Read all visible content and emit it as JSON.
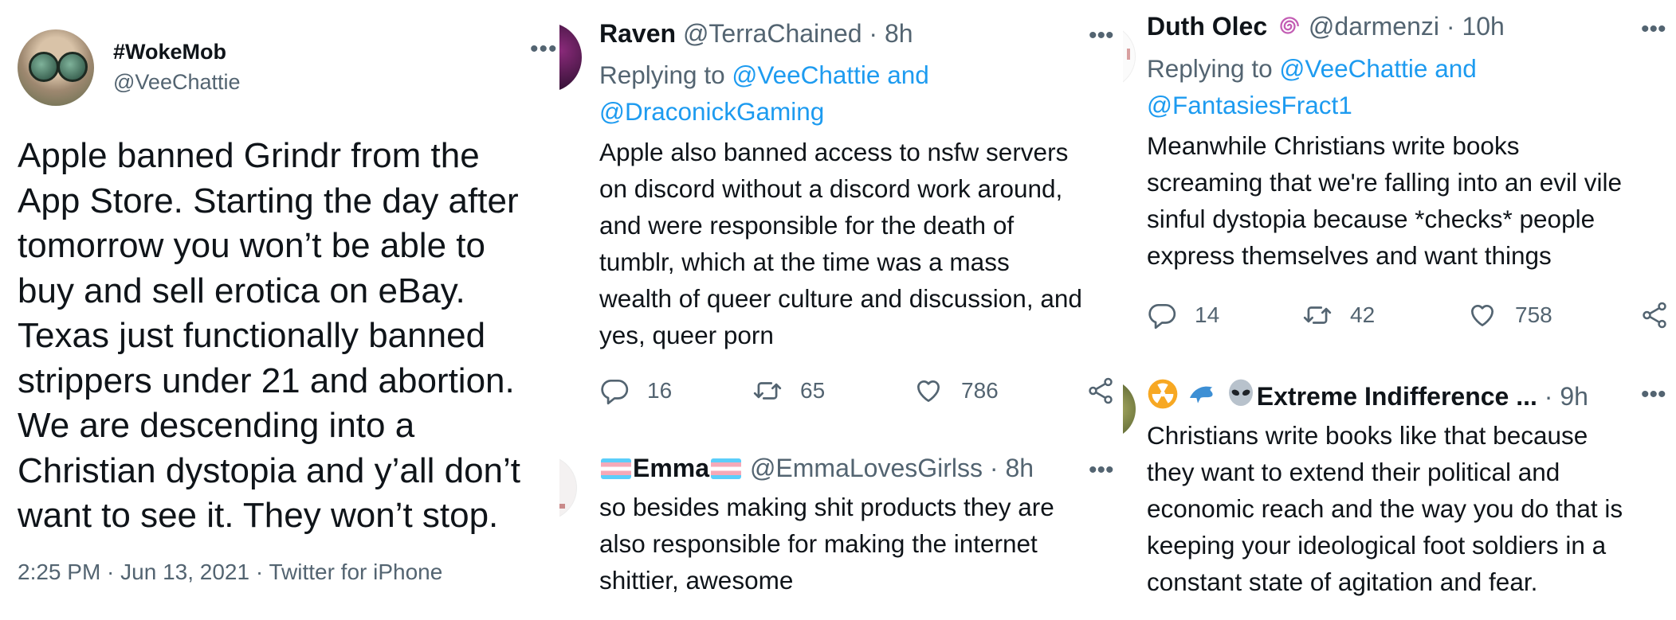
{
  "main_tweet": {
    "display_name": "#WokeMob",
    "handle": "@VeeChattie",
    "text": "Apple banned Grindr from the\nApp Store. Starting the day after\ntomorrow you won’t be able to\nbuy and sell erotica on eBay.\nTexas just functionally banned\nstrippers under 21 and abortion.\nWe are descending into a\nChristian dystopia and y’all don’t\nwant to see it. They won’t stop.",
    "meta": "2:25 PM · Jun 13, 2021 · Twitter for iPhone",
    "more_icon": "more-dots-icon"
  },
  "reply_raven": {
    "display_name": "Raven",
    "handle": "@TerraChained",
    "time": "· 8h",
    "replying_prefix": "Replying to",
    "replying_line1": "@VeeChattie and",
    "replying_line2": "@DraconickGaming",
    "text": "Apple also banned access to nsfw servers\non discord without a discord work around,\nand were responsible for the death of\ntumblr, which at the time was a mass\nwealth of queer culture and discussion, and\nyes, queer porn",
    "replies": "16",
    "retweets": "65",
    "likes": "786"
  },
  "reply_emma": {
    "display_name": "Emma",
    "handle": "@EmmaLovesGirlss",
    "time": "· 8h",
    "text": "so besides making shit products they are\nalso responsible for making the internet\nshittier, awesome"
  },
  "reply_duth": {
    "display_name": "Duth Olec",
    "handle": "@darmenzi",
    "time": "· 10h",
    "replying_prefix": "Replying to",
    "replying_line1": "@VeeChattie and",
    "replying_line2": "@FantasiesFract1",
    "text": "Meanwhile Christians write books\nscreaming that we're falling into an evil vile\nsinful dystopia because *checks* people\nexpress themselves and want things",
    "replies": "14",
    "retweets": "42",
    "likes": "758"
  },
  "reply_extreme": {
    "display_name": "Extreme Indifference ...",
    "time": "· 9h",
    "text": "Christians write books like that because\nthey want to extend their political and\neconomic reach and the way you do that is\nkeeping your ideological foot soldiers in a\nconstant state of agitation and fear."
  },
  "colors": {
    "text": "#0f1419",
    "secondary": "#536471",
    "link": "#1d9bf0"
  }
}
